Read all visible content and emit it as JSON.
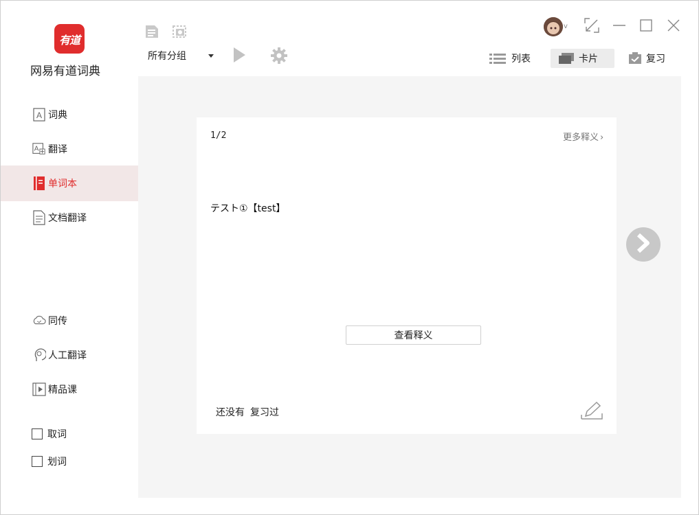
{
  "app": {
    "logo_text": "有道",
    "title": "网易有道词典"
  },
  "sidebar": {
    "items": [
      {
        "label": "词典",
        "icon": "dictionary-icon"
      },
      {
        "label": "翻译",
        "icon": "translate-icon"
      },
      {
        "label": "单词本",
        "icon": "wordbook-icon",
        "active": true
      },
      {
        "label": "文档翻译",
        "icon": "document-translate-icon"
      },
      {
        "label": "同传",
        "icon": "simultaneous-interpret-icon"
      },
      {
        "label": "人工翻译",
        "icon": "human-translate-icon"
      },
      {
        "label": "精品课",
        "icon": "course-icon"
      }
    ],
    "checkboxes": [
      {
        "label": "取词",
        "checked": false
      },
      {
        "label": "划词",
        "checked": false
      }
    ]
  },
  "toolbar": {
    "group_select": "所有分组",
    "views": {
      "list": "列表",
      "card": "卡片",
      "review": "复习"
    },
    "active_view": "card"
  },
  "card": {
    "counter": "1/2",
    "more_label": "更多释义",
    "word": "テスト①【test】",
    "reveal_button": "查看释义",
    "status_part1": "还没有",
    "status_part2": "复习过"
  },
  "colors": {
    "accent": "#e02d2d",
    "active_bg": "#f2e7e7",
    "content_bg": "#f5f5f5"
  }
}
